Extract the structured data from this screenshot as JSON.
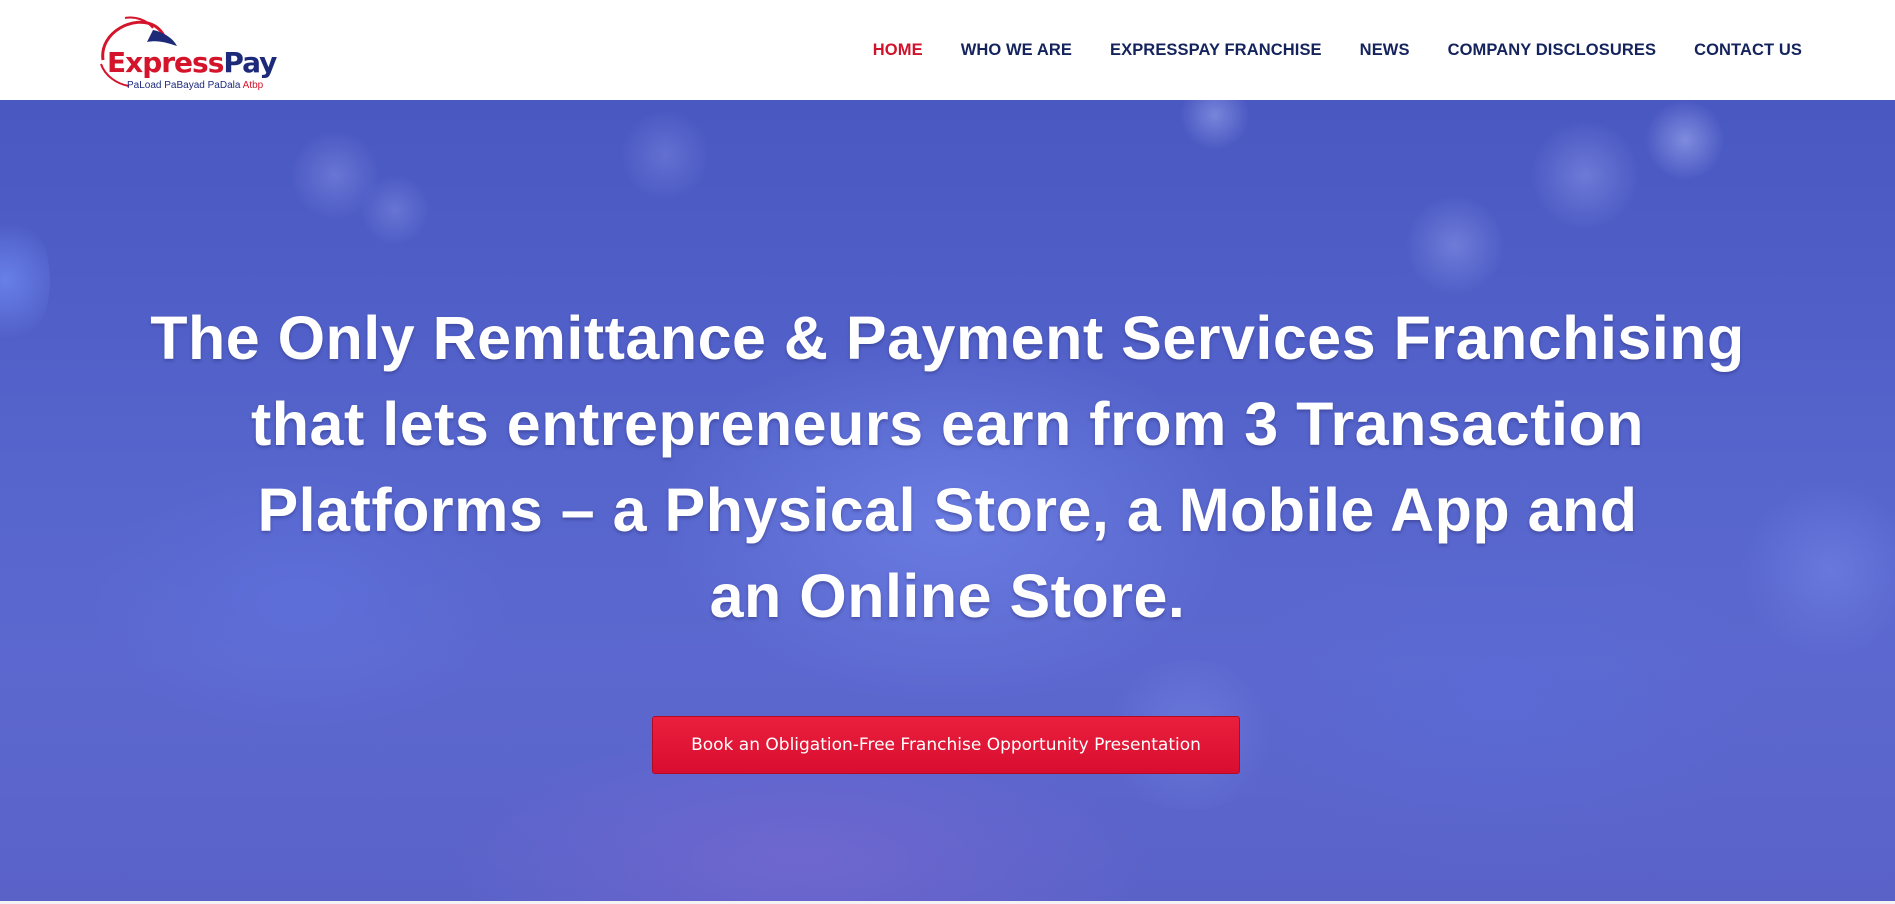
{
  "brand": {
    "name_part1": "Express",
    "name_part2": "Pay",
    "tagline_part1": "PaLoad PaBayad PaDala",
    "tagline_part2": "Atbp",
    "colors": {
      "red": "#d4142a",
      "navy": "#1d2a7a"
    }
  },
  "nav": {
    "items": [
      {
        "label": "HOME",
        "active": true
      },
      {
        "label": "WHO WE ARE",
        "active": false
      },
      {
        "label": "EXPRESSPAY FRANCHISE",
        "active": false
      },
      {
        "label": "NEWS",
        "active": false
      },
      {
        "label": "COMPANY DISCLOSURES",
        "active": false
      },
      {
        "label": "CONTACT US",
        "active": false
      }
    ],
    "colors": {
      "default": "#14235c",
      "active": "#d0122b"
    }
  },
  "hero": {
    "headline_lines": [
      "The Only Remittance & Payment Services Franchising",
      "that lets entrepreneurs earn from 3 Transaction",
      "Platforms – a Physical Store, a Mobile App and",
      "an Online Store."
    ],
    "cta_label": "Book an Obligation-Free Franchise Opportunity Presentation",
    "colors": {
      "background": "#5363cb",
      "cta": "#e0163a",
      "text": "#ffffff"
    }
  }
}
